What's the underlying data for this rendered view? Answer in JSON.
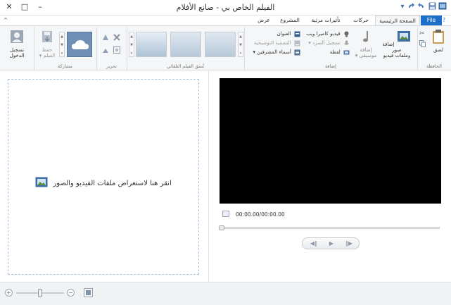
{
  "window": {
    "title": "الفيلم الخاص بي - صانع الأفلام",
    "minimize": "–",
    "maximize": "□",
    "close": "✕"
  },
  "quick_access": {
    "save_icon": "save-icon",
    "undo_icon": "undo-icon",
    "redo_icon": "redo-icon",
    "dropdown": "▾"
  },
  "tabs": {
    "file": "File",
    "home": "الصفحة الرئيسية",
    "animations": "حركات",
    "visual_effects": "تأثيرات مرئية",
    "project": "المشروع",
    "view": "عرض",
    "collapse": "^",
    "help": "?"
  },
  "ribbon": {
    "clipboard": {
      "label": "الحافظة",
      "paste": "لصق"
    },
    "add": {
      "label": "إضافة",
      "add_videos_photos_line1": "إضافة صور",
      "add_videos_photos_line2": "وملفات فيديو",
      "add_music_line1": "إضافة",
      "add_music_line2": "موسيقى ▾",
      "webcam_video": "فيديو كاميرا ويب",
      "record_narration": "تسجيل السرد ▾",
      "snapshot": "لقطة",
      "title": "العنوان",
      "caption": "التسمية التوضيحية",
      "credits": "أسماء المشرفين ▾"
    },
    "automovie": {
      "label": "نُسق الفيلم التلقائي"
    },
    "editing": {
      "label": "تحرير"
    },
    "sharing": {
      "label": "مشاركة",
      "save_movie_line1": "حفظ",
      "save_movie_line2": "الفيلم ▾"
    },
    "signin": {
      "line1": "تسجيل",
      "line2": "الدخول"
    }
  },
  "storyboard": {
    "placeholder": "انقر هنا لاستعراض ملفات الفيديو والصور"
  },
  "preview": {
    "timecode": "00:00.00/00:00.00",
    "seek_position": 0
  },
  "playback": {
    "prev_frame": "◀‖",
    "play": "▶",
    "next_frame": "‖▶"
  },
  "statusbar": {
    "zoom_out": "−",
    "zoom_in": "+",
    "zoom_level_fraction": 0.5
  },
  "colors": {
    "file_tab": "#1e6fc9",
    "preview_bg": "#000000",
    "storyboard_border": "#a7c4e0"
  }
}
